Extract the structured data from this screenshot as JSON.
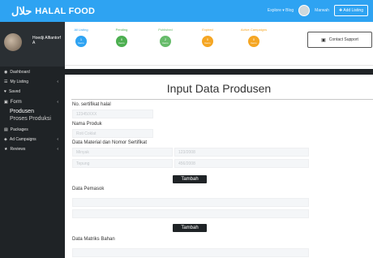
{
  "brand": {
    "logo_mark": "ﺣﻼل",
    "name": "HALAL FOOD"
  },
  "topbar": {
    "links": "Explore ▾   Blog",
    "user": "Marwah",
    "add_listing": "✚ Add Listing"
  },
  "sidebar": {
    "user_name": "Hoedji Alfiantorf A",
    "items": [
      {
        "label": "Dashboard",
        "icon": "dashboard-icon",
        "glyph": "◉",
        "caret": ""
      },
      {
        "label": "My Listing",
        "icon": "list-icon",
        "glyph": "☰",
        "caret": "‹"
      },
      {
        "label": "Saved",
        "icon": "heart-icon",
        "glyph": "♥",
        "caret": ""
      },
      {
        "label": "Form",
        "icon": "form-icon",
        "glyph": "▣",
        "caret": "‹"
      },
      {
        "label": "Produsen",
        "sub": true,
        "active": true
      },
      {
        "label": "Proses Produksi",
        "sub": true
      },
      {
        "label": "Packages",
        "icon": "package-icon",
        "glyph": "▤",
        "caret": ""
      },
      {
        "label": "Ad Campaigns",
        "icon": "campaign-icon",
        "glyph": "◈",
        "caret": "‹"
      },
      {
        "label": "Reviews",
        "icon": "star-icon",
        "glyph": "★",
        "caret": "‹"
      }
    ]
  },
  "stats": [
    {
      "label": "All Listing",
      "value": "1",
      "unit": "Items",
      "color": "#2ea3f2"
    },
    {
      "label": "Pending",
      "value": "0",
      "unit": "Items",
      "color": "#4caf50"
    },
    {
      "label": "Published",
      "value": "2",
      "unit": "Items",
      "color": "#66bb6a"
    },
    {
      "label": "Expired",
      "value": "0",
      "unit": "Items",
      "color": "#f5a623"
    },
    {
      "label": "Active Campaigns",
      "value": "0",
      "unit": "Items",
      "color": "#f5a623"
    }
  ],
  "support_label": "Contact Support",
  "form": {
    "title": "Input Data Produsen",
    "sertifikat_label": "No. sertifikat halal",
    "sertifikat_placeholder": "12345/XXX",
    "produk_label": "Nama Produk",
    "produk_placeholder": "Roti Coklat",
    "material_label": "Data Material dan Nomor Sertifikat",
    "material_rows": [
      {
        "name": "Minyak",
        "cert": "123/2008"
      },
      {
        "name": "Tepung",
        "cert": "456/2008"
      }
    ],
    "tambah_label": "Tambah",
    "pemasok_label": "Data Pemasok",
    "matriks_label": "Data Matriks Bahan"
  }
}
